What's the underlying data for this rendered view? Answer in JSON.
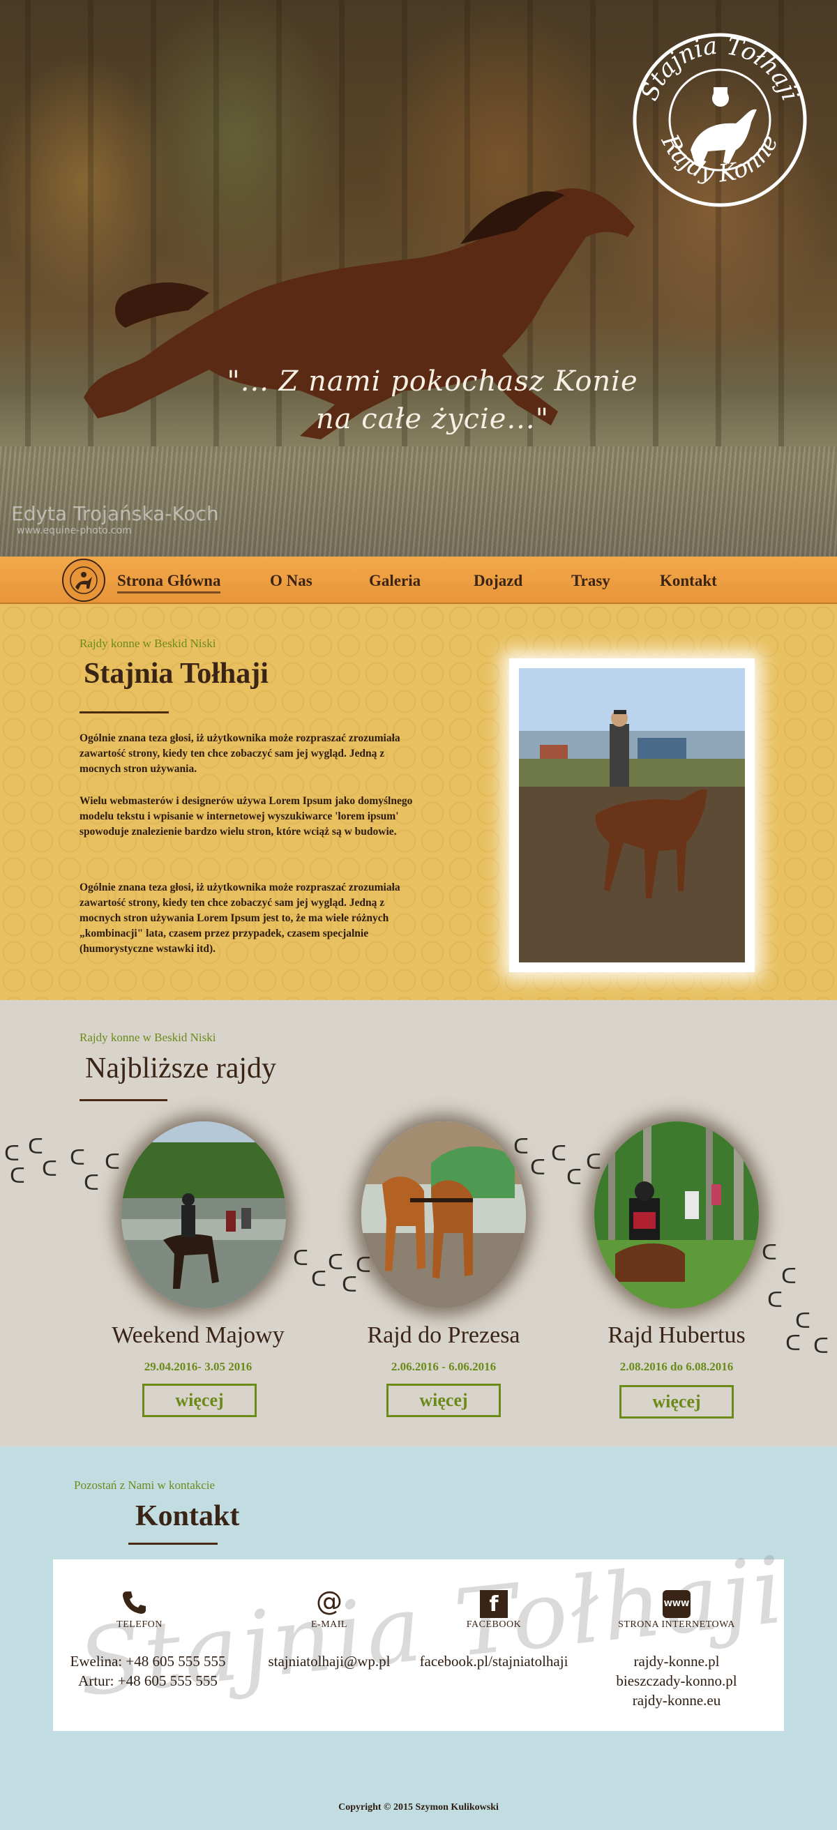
{
  "hero": {
    "quote_line1": "\"... Z nami pokochasz Konie",
    "quote_line2": "na całe życie...\"",
    "photo_credit": "Edyta Trojańska-Koch",
    "photo_credit_url": "www.equine-photo.com",
    "logo_text_top": "Stajnia Tołhaji",
    "logo_text_bottom": "Rajdy Konne"
  },
  "nav": {
    "items": [
      {
        "label": "Strona Główna",
        "active": true
      },
      {
        "label": "O Nas"
      },
      {
        "label": "Galeria"
      },
      {
        "label": "Dojazd"
      },
      {
        "label": "Trasy"
      },
      {
        "label": "Kontakt"
      }
    ]
  },
  "intro": {
    "kicker": "Rajdy konne w Beskid Niski",
    "title": "Stajnia Tołhaji",
    "paragraphs": [
      "Ogólnie znana teza głosi, iż użytkownika może rozpraszać zrozumiała zawartość strony, kiedy ten chce zobaczyć sam jej wygląd. Jedną z mocnych stron używania.",
      "Wielu webmasterów i designerów używa Lorem Ipsum jako domyślnego modelu tekstu i wpisanie w internetowej wyszukiwarce 'lorem ipsum' spowoduje znalezienie bardzo wielu stron, które wciąż są w budowie.",
      "Ogólnie znana teza głosi, iż użytkownika może rozpraszać zrozumiała zawartość strony, kiedy ten chce zobaczyć sam jej wygląd. Jedną z mocnych stron używania Lorem Ipsum jest to, że ma wiele różnych „kombinacji\" lata, czasem przez przypadek, czasem specjalnie (humorystyczne wstawki itd)."
    ]
  },
  "rides": {
    "kicker": "Rajdy konne w Beskid Niski",
    "title": "Najbliższe rajdy",
    "items": [
      {
        "name": "Weekend Majowy",
        "date": "29.04.2016- 3.05 2016",
        "button": "więcej"
      },
      {
        "name": "Rajd do Prezesa",
        "date": "2.06.2016 - 6.06.2016",
        "button": "więcej"
      },
      {
        "name": "Rajd Hubertus",
        "date": "2.08.2016 do 6.08.2016",
        "button": "więcej"
      }
    ]
  },
  "contact": {
    "kicker": "Pozostań z Nami w kontakcie",
    "title": "Kontakt",
    "watermark": "Stajnia Tołhaji",
    "phone_label": "TELEFON",
    "phone_1": "Ewelina: +48 605 555 555",
    "phone_2": "Artur: +48 605 555 555",
    "email_label": "E-MAIL",
    "email": "stajniatolhaji@wp.pl",
    "facebook_label": "FACEBOOK",
    "facebook": "facebook.pl/stajniatolhaji",
    "www_label": "STRONA INTERNETOWA",
    "www_icon_text": "WWW",
    "www_1": "rajdy-konne.pl",
    "www_2": "bieszczady-konno.pl",
    "www_3": "rajdy-konne.eu"
  },
  "footer": {
    "copyright": "Copyright © 2015 Szymon Kulikowski"
  },
  "colors": {
    "nav_orange": "#f2a94a",
    "intro_yellow": "#e8c060",
    "accent_green": "#6c8a1a",
    "brown_text": "#3a2415",
    "contact_blue": "#c2dde2"
  }
}
